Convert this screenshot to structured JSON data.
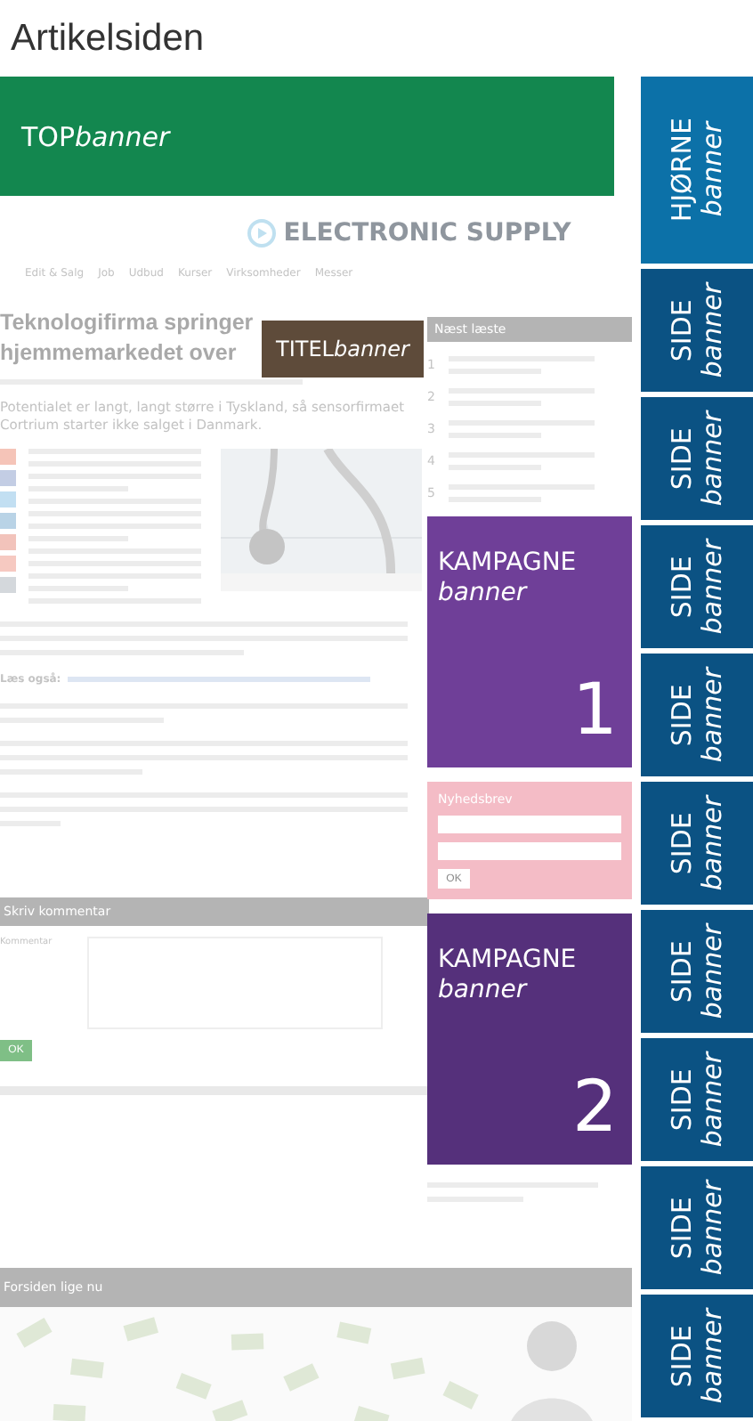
{
  "title": "Artikelsiden",
  "banners": [
    {
      "kind": "top",
      "label": "TOP",
      "suffix": "banner"
    },
    {
      "kind": "title",
      "label": "TITEL",
      "suffix": "banner"
    },
    {
      "kind": "campaign",
      "label": "KAMPAGNE",
      "suffix": "banner",
      "number": "1"
    },
    {
      "kind": "campaign",
      "label": "KAMPAGNE",
      "suffix": "banner",
      "number": "2"
    }
  ],
  "side_banners": [
    {
      "kind": "corner",
      "label": "HJØRNE",
      "suffix": "banner"
    },
    {
      "kind": "side",
      "label": "SIDE",
      "suffix": "banner"
    },
    {
      "kind": "side",
      "label": "SIDE",
      "suffix": "banner"
    },
    {
      "kind": "side",
      "label": "SIDE",
      "suffix": "banner"
    },
    {
      "kind": "side",
      "label": "SIDE",
      "suffix": "banner"
    },
    {
      "kind": "side",
      "label": "SIDE",
      "suffix": "banner"
    },
    {
      "kind": "side",
      "label": "SIDE",
      "suffix": "banner"
    },
    {
      "kind": "side",
      "label": "SIDE",
      "suffix": "banner"
    },
    {
      "kind": "side",
      "label": "SIDE",
      "suffix": "banner"
    },
    {
      "kind": "side",
      "label": "SIDE",
      "suffix": "banner"
    }
  ],
  "page": {
    "logo": "ELECTRONIC SUPPLY",
    "menu": [
      "Edit & Salg",
      "Job",
      "Udbud",
      "Kurser",
      "Virksomheder",
      "Messer"
    ],
    "headline": "Teknologifirma springer hjemmemarkedet over",
    "lead": "Potentialet er langt, langt større i Tyskland, så sensorfirmaet Cortrium starter ikke salget i Danmark.",
    "read_also": "Læs også:",
    "comment_heading": "Skriv kommentar",
    "comment_label": "Kommentar",
    "comment_button": "OK",
    "front_heading": "Forsiden lige nu",
    "most_read_heading": "Næst læste",
    "most_read": [
      "1",
      "2",
      "3",
      "4",
      "5"
    ],
    "newsletter_heading": "Nyhedsbrev",
    "newsletter_button": "OK"
  }
}
